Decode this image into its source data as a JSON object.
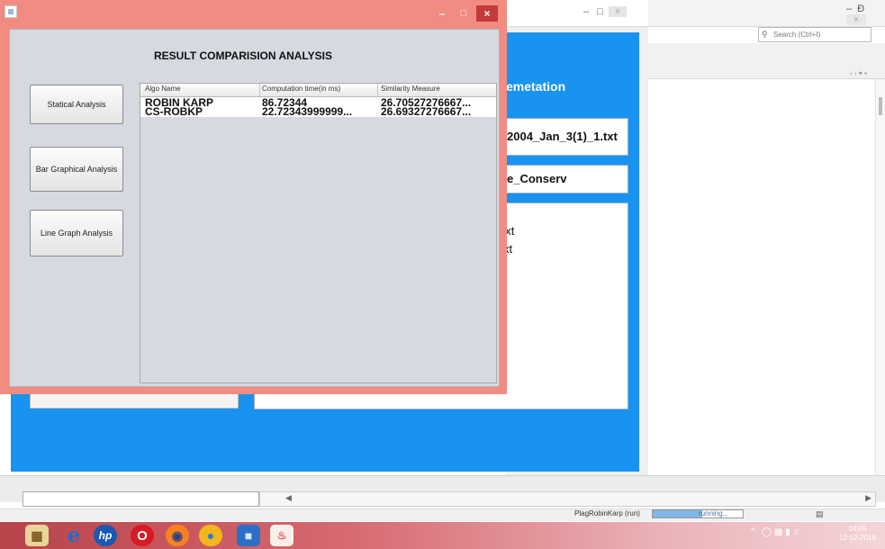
{
  "dialog": {
    "heading": "RESULT COMPARISION ANALYSIS",
    "minimize": "–",
    "maximize": "□",
    "close": "×",
    "buttons": [
      "Statical Analysis",
      "Bar Graphical Analysis",
      "Line Graph Analysis"
    ],
    "table": {
      "columns": [
        "Algo Name",
        "Computation time(in ms)",
        "Similarity Measure"
      ],
      "rows": [
        [
          "ROBIN KARP",
          "86.72344",
          "26.70527276667..."
        ],
        [
          "CS-ROBKP",
          "22.72343999999...",
          "26.69327276667..."
        ]
      ]
    }
  },
  "background_window": {
    "title_fragment": "emetation",
    "field1_fragment": "2004_Jan_3(1)_1.txt",
    "field2_fragment": "e_Conserv",
    "list_fragments": [
      ".txt",
      "xt"
    ],
    "minimize": "–",
    "maximize": "□",
    "close": "×"
  },
  "ide": {
    "search_placeholder": "Search (Ctrl+I)",
    "nav_arrows": "‹ › ▾ ▪",
    "minimize": "–",
    "restore": "Ɖ",
    "close": "×",
    "status_project": "PlagRobinKarp (run)",
    "status_running": "running...",
    "progress": 0.55
  },
  "taskbar": {
    "icons": [
      "file-explorer-icon",
      "internet-explorer-icon",
      "hp-icon",
      "opera-icon",
      "firefox-icon",
      "chrome-icon",
      "app-cube-icon",
      "java-app-icon"
    ],
    "time": "14:09",
    "date": "12-12-2018"
  },
  "colors": {
    "dialog_frame": "#f28b82",
    "dialog_close": "#c43b3b",
    "blue_panel": "#1893f0",
    "dialog_body": "#d6d9e0"
  }
}
